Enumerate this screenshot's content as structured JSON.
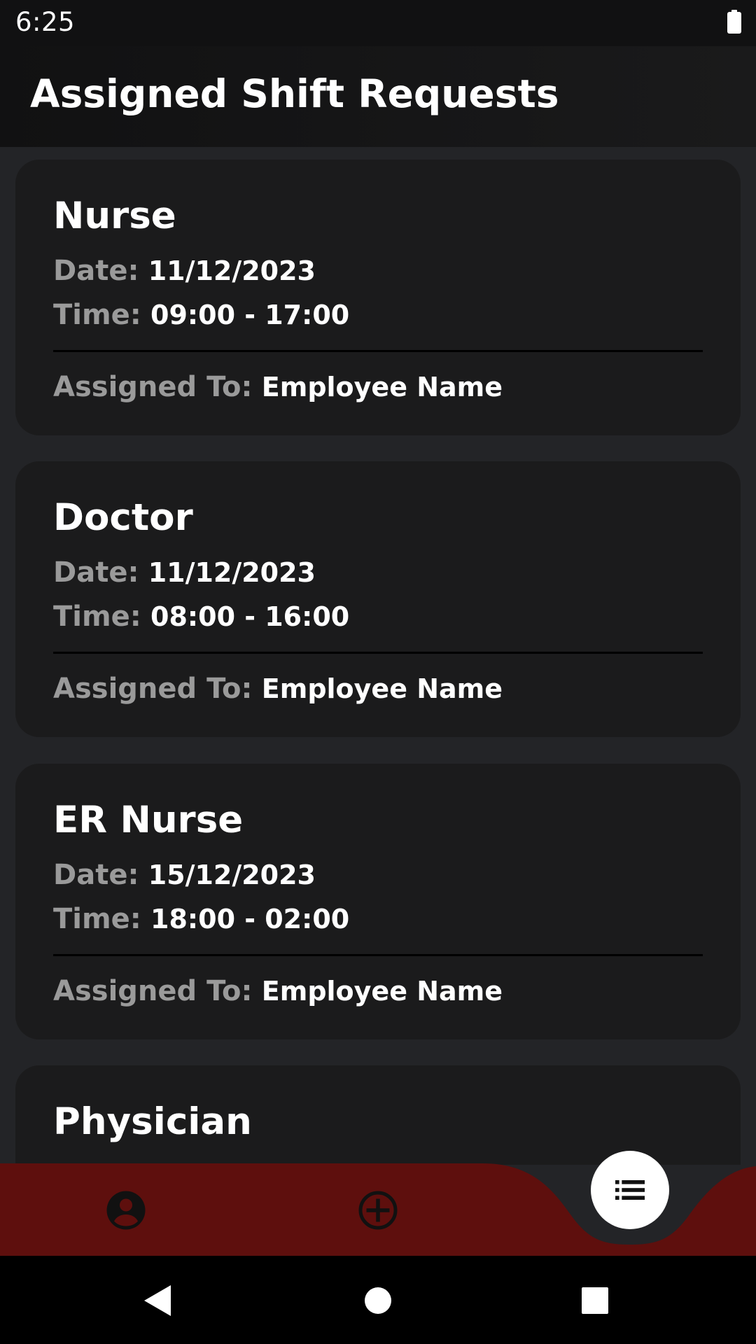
{
  "status_bar": {
    "time": "6:25",
    "battery_icon": "battery-full-icon"
  },
  "app_bar": {
    "title": "Assigned Shift Requests"
  },
  "labels": {
    "date": "Date:",
    "time": "Time:",
    "assigned_to": "Assigned To:"
  },
  "shifts": [
    {
      "role": "Nurse",
      "date": "11/12/2023",
      "time": "09:00 - 17:00",
      "assigned_to": "Employee Name"
    },
    {
      "role": "Doctor",
      "date": "11/12/2023",
      "time": "08:00 - 16:00",
      "assigned_to": "Employee Name"
    },
    {
      "role": "ER Nurse",
      "date": "15/12/2023",
      "time": "18:00 - 02:00",
      "assigned_to": "Employee Name"
    },
    {
      "role": "Physician"
    }
  ],
  "bottom_nav": {
    "items": [
      {
        "icon": "account-circle-icon"
      },
      {
        "icon": "add-circle-icon"
      },
      {
        "icon": "list-icon",
        "selected": true
      }
    ],
    "background_color": "#5e0f0d",
    "fab_color": "#ffffff"
  },
  "system_nav": {
    "buttons": [
      "back-icon",
      "home-icon",
      "recents-icon"
    ]
  }
}
